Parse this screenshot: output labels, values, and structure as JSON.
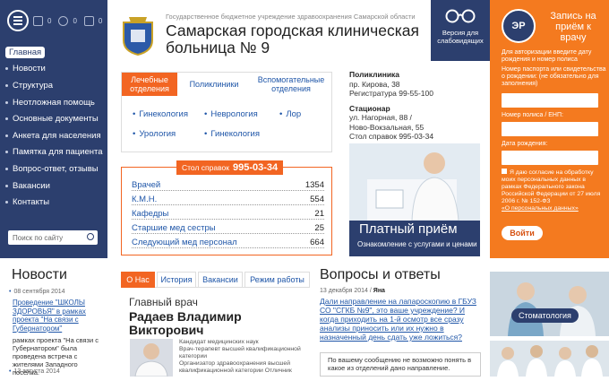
{
  "sidebar": {
    "counters": [
      "0",
      "0",
      "0"
    ],
    "nav": [
      {
        "label": "Главная",
        "active": true
      },
      {
        "label": "Новости"
      },
      {
        "label": "Структура"
      },
      {
        "label": "Неотложная помощь"
      },
      {
        "label": "Основные документы"
      },
      {
        "label": "Анкета для населения"
      },
      {
        "label": "Памятка для пациента"
      },
      {
        "label": "Вопрос-ответ, отзывы"
      },
      {
        "label": "Вакансии"
      },
      {
        "label": "Контакты"
      }
    ],
    "search_placeholder": "Поиск по сайту"
  },
  "header": {
    "org": "Государственное бюджетное учреждение здравоохранения Самарской области",
    "name_line1": "Самарская городская клиническая",
    "name_line2": "больница № 9",
    "vision_line1": "Версия для",
    "vision_line2": "слабовидящих"
  },
  "departments": {
    "tabs": [
      {
        "line1": "Лечебные",
        "line2": "отделения"
      },
      {
        "line1": "Поликлиники",
        "line2": ""
      },
      {
        "line1": "Вспомогательные",
        "line2": "отделения"
      }
    ],
    "links": [
      "Гинекология",
      "Неврология",
      "Лор",
      "Урология",
      "Гинекология"
    ]
  },
  "contacts": {
    "clinic_title": "Поликлиника",
    "clinic_lines": [
      "пр. Кирова, 38",
      "Регистратура   99-55-100"
    ],
    "hospital_title": "Стационар",
    "hospital_lines": [
      "ул. Нагорная, 88 /",
      "Ново-Вокзальная, 55",
      "Стол справок  995-03-34"
    ]
  },
  "stats": {
    "head_label": "Стол справок",
    "head_phone": "995-03-34",
    "rows": [
      {
        "label": "Врачей",
        "value": "1354"
      },
      {
        "label": "К.М.Н.",
        "value": "554"
      },
      {
        "label": "Кафедры",
        "value": "21"
      },
      {
        "label": "Старшие мед сестры",
        "value": "25"
      },
      {
        "label": "Следующий мед персонал",
        "value": "664"
      }
    ]
  },
  "paid": {
    "title": "Платный приём",
    "subtitle": "Ознакомление с услугами и ценами"
  },
  "register": {
    "logo": "ЭР",
    "title": "Запись на приём к врачу",
    "subtitle": "Для авторизации введите дату рождения и номер полиса",
    "field1_label": "Номер паспорта или свидетельства о рождении: (не обязательно для заполнения)",
    "field2_label": "Номер полиса / ЕНП:",
    "field3_label": "Дата рождения:",
    "agree_text": "Я даю согласие на обработку моих персональных данных в рамках Федерального закона Российской Федерации от 27 июля 2006 г. № 152-ФЗ",
    "agree_link": "«О персональных данных»",
    "button": "Войти"
  },
  "news": {
    "title": "Новости",
    "items": [
      {
        "date": "08 сентября 2014",
        "link": "Проведение \"ШКОЛЫ ЗДОРОВЬЯ\" в рамках проекта \"На связи с Губернатором\"",
        "text": "рамках проекта \"На связи с Губернатором\" была проведена встреча с жителями Западного поселка."
      },
      {
        "date": "13 августа 2014"
      }
    ]
  },
  "about": {
    "tabs": [
      "О Нас",
      "История",
      "Вакансии",
      "Режим работы"
    ],
    "chief_label": "Главный врач",
    "chief_name": "Радаев Владимир Викторович",
    "chief_info": [
      "Кандидат медицинских наук",
      "Врач-терапевт высшей квалификационной категории",
      "Организатор здравоохранения высшей квалификационной категории Отличник"
    ]
  },
  "qa": {
    "title": "Вопросы и ответы",
    "date": "13 декабря 2014",
    "author": "Яна",
    "question": "Дали направление на лапароскопию в ГБУЗ СО \"СГКБ №9\", это ваше учреждение? И когда приходить на 1-й осмотр все сразу анализы приносить или их нужно в назначенный день сдать уже ложиться?",
    "answer": "По вашему сообщению не возможно понять в какое из отделений дано направление."
  },
  "promo": {
    "stomatology": "Стоматология"
  }
}
